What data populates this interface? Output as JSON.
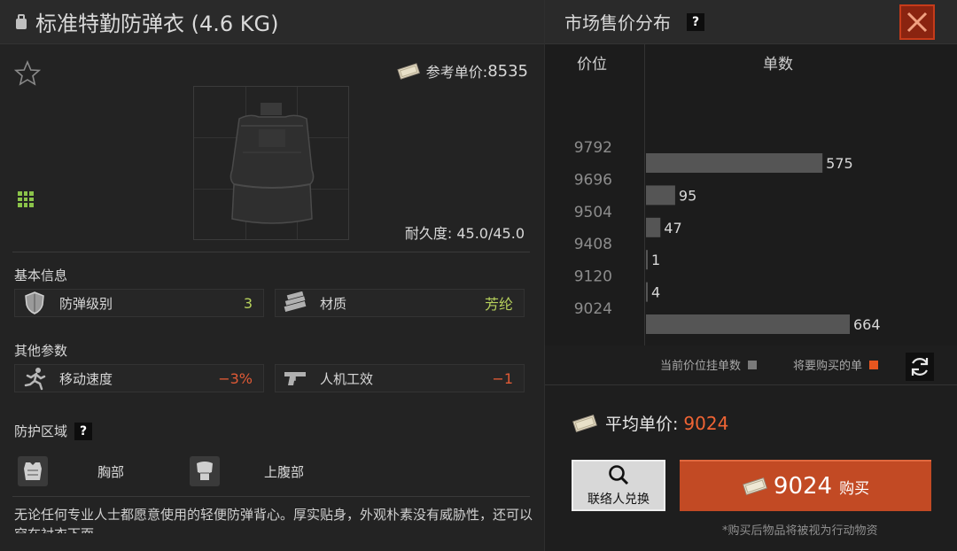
{
  "header": {
    "title": "标准特勤防弹衣 (4.6 KG)"
  },
  "item": {
    "ref_price_label": "参考单价:",
    "ref_price": "8535",
    "durability": "耐久度: 45.0/45.0"
  },
  "basic_info": {
    "label": "基本信息",
    "armor_level_label": "防弹级别",
    "armor_level_value": "3",
    "material_label": "材质",
    "material_value": "芳纶"
  },
  "other_params": {
    "label": "其他参数",
    "move_speed_label": "移动速度",
    "move_speed_value": "−3%",
    "ergonomics_label": "人机工效",
    "ergonomics_value": "−1"
  },
  "protection": {
    "label": "防护区域",
    "help": "?",
    "zones": [
      "胸部",
      "上腹部"
    ]
  },
  "description": "无论任何专业人士都愿意使用的轻便防弹背心。厚实贴身，外观朴素没有威胁性，还可以穿在衬衣下面。",
  "market": {
    "title": "市场售价分布",
    "help": "?",
    "col_price": "价位",
    "col_count": "单数",
    "legend_current": "当前价位挂单数",
    "legend_to_buy": "将要购买的单",
    "avg_label": "平均单价:",
    "avg_value": "9024",
    "exchange_label": "联络人兑换",
    "buy_price": "9024",
    "buy_label": "购买",
    "buy_note": "*购买后物品将被视为行动物资"
  },
  "colors": {
    "accent": "#f06434",
    "bar_current": "#555555",
    "bar_to_buy": "#e8561f",
    "positive": "#b7d15c"
  },
  "chart_data": {
    "type": "bar",
    "orientation": "horizontal",
    "categories": [
      "9792",
      "9696",
      "9504",
      "9408",
      "9120",
      "9024"
    ],
    "values": [
      575,
      95,
      47,
      1,
      4,
      664
    ],
    "xlabel": "单数",
    "ylabel": "价位"
  }
}
